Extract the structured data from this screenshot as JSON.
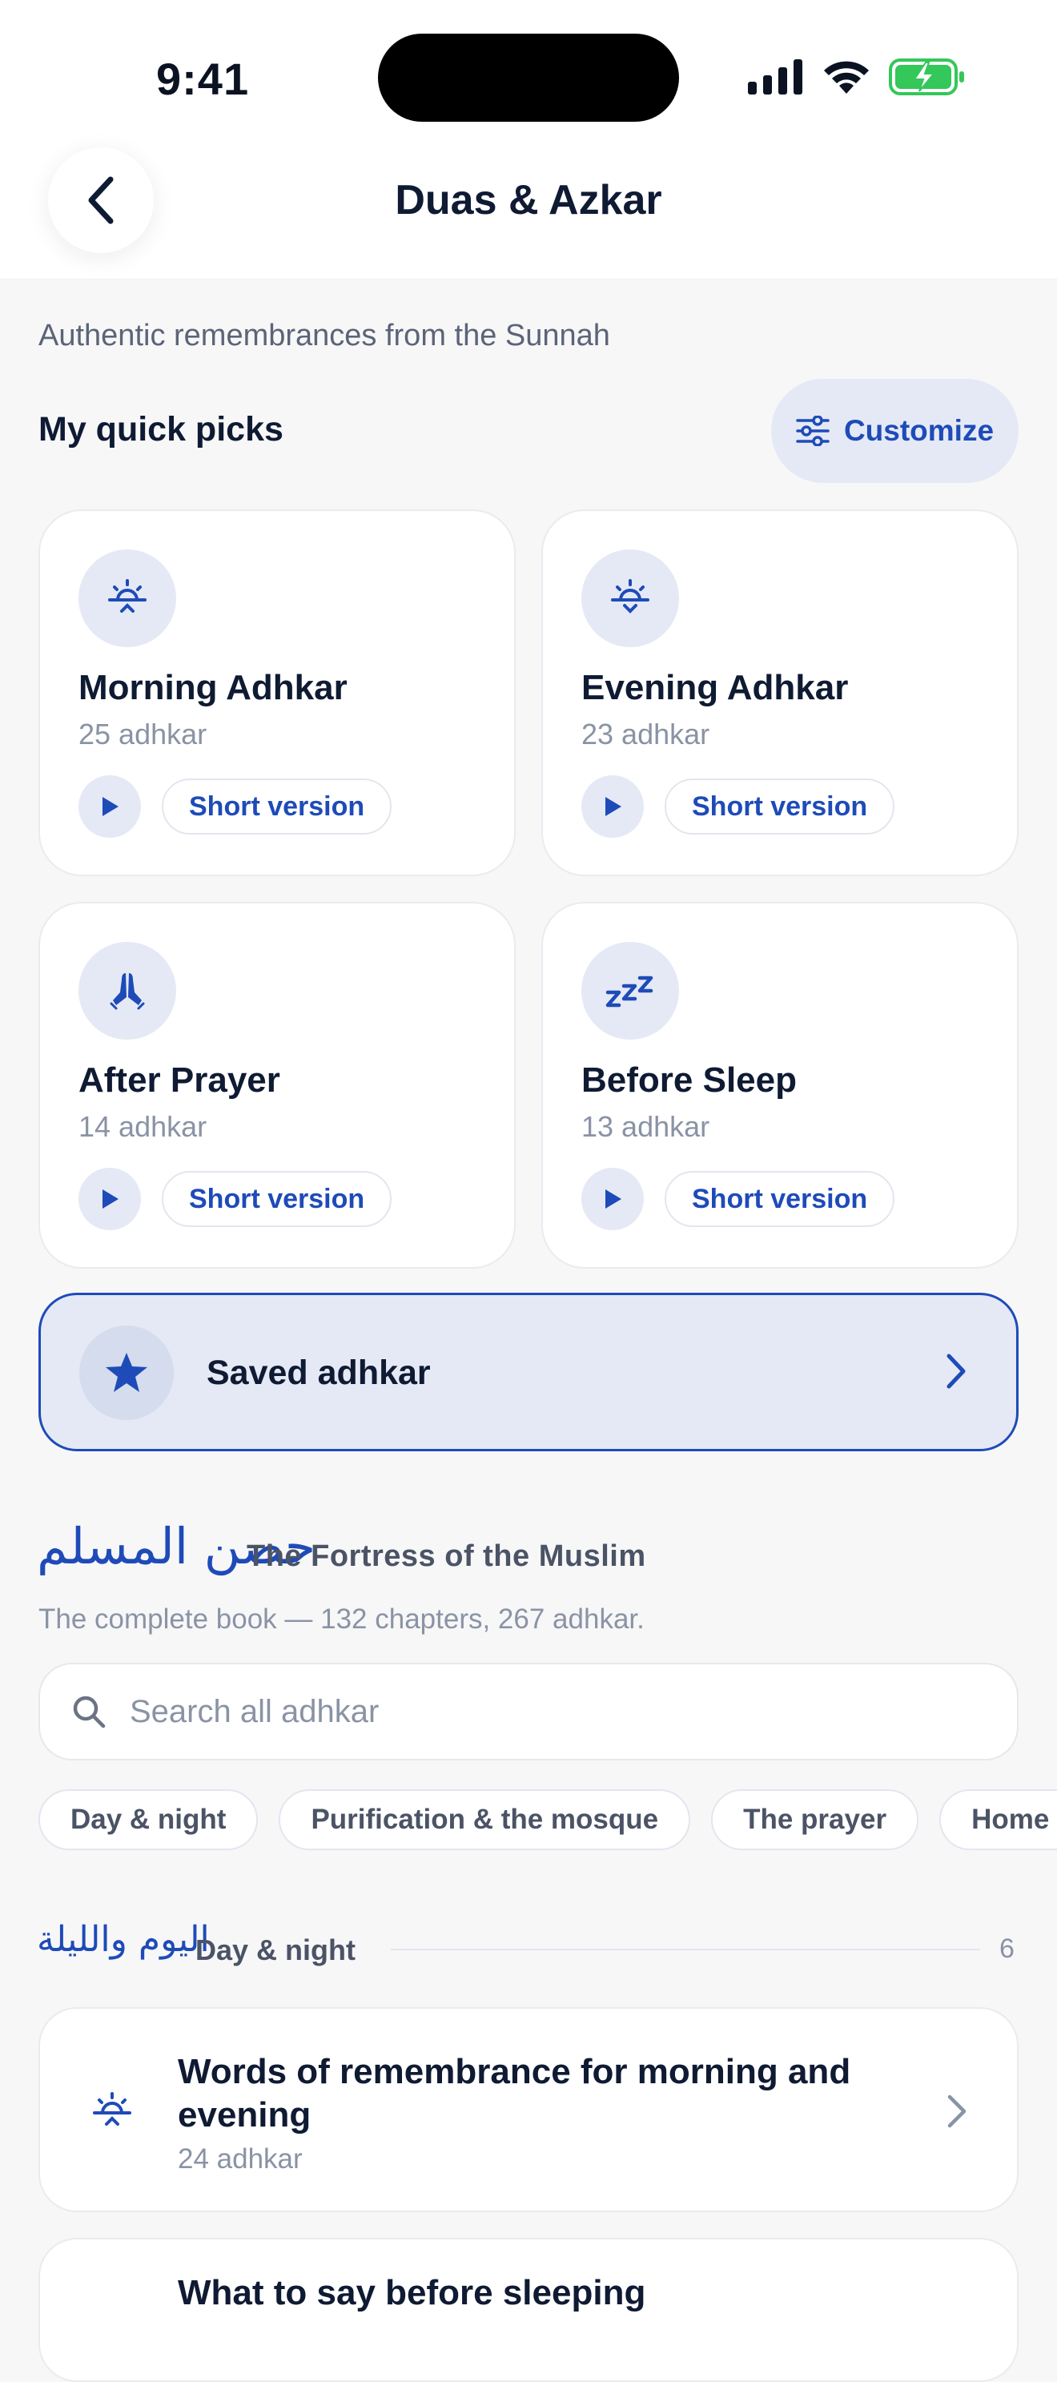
{
  "status_bar": {
    "time": "9:41"
  },
  "header": {
    "title": "Duas & Azkar"
  },
  "subtitle": "Authentic remembrances from the Sunnah",
  "quick_picks": {
    "heading": "My quick picks",
    "customize_label": "Customize",
    "cards": [
      {
        "title": "Morning Adhkar",
        "count": "25 adhkar",
        "icon": "sunrise-icon",
        "short_label": "Short version"
      },
      {
        "title": "Evening Adhkar",
        "count": "23 adhkar",
        "icon": "sunset-icon",
        "short_label": "Short version"
      },
      {
        "title": "After Prayer",
        "count": "14 adhkar",
        "icon": "praying-hands-icon",
        "short_label": "Short version"
      },
      {
        "title": "Before Sleep",
        "count": "13 adhkar",
        "icon": "zzz-sleep-icon",
        "short_label": "Short version"
      }
    ]
  },
  "saved": {
    "label": "Saved adhkar"
  },
  "fortress": {
    "arabic_title": "حصن المسلم",
    "title": "The Fortress of the Muslim",
    "description": "The complete book — 132 chapters, 267 adhkar.",
    "search_placeholder": "Search all adhkar",
    "chips": [
      "Day & night",
      "Purification & the mosque",
      "The prayer",
      "Home & family"
    ]
  },
  "group": {
    "arabic_title": "اليوم والليلة",
    "title": "Day & night",
    "count": "6",
    "rows": [
      {
        "title": "Words of remembrance for morning and evening",
        "count": "24 adhkar"
      },
      {
        "title": "What to say before sleeping",
        "count": ""
      }
    ]
  },
  "colors": {
    "accent": "#1e4bb8",
    "accent_light": "#e4e9f5",
    "background": "#f7f7f8",
    "battery": "#34c759"
  }
}
